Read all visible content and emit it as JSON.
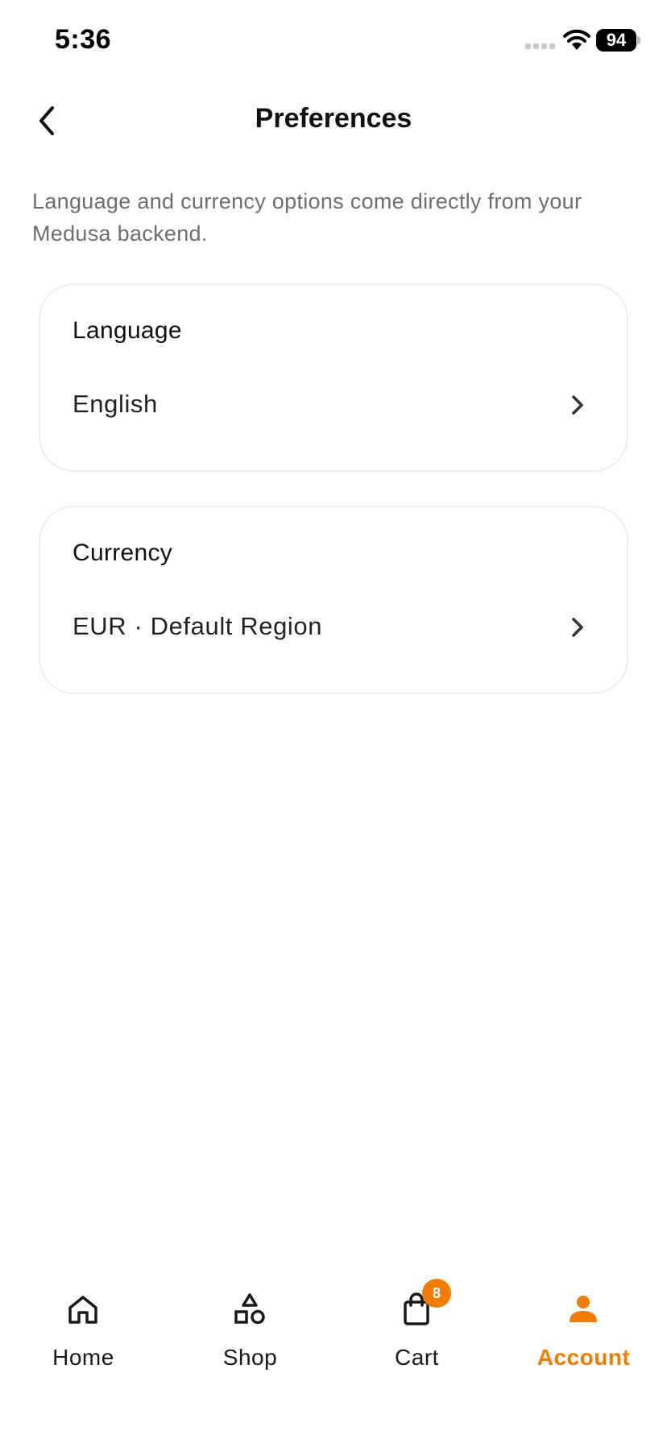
{
  "status_bar": {
    "time": "5:36",
    "battery": "94",
    "icons": [
      "cellular-signal-icon",
      "wifi-icon",
      "battery-icon"
    ]
  },
  "header": {
    "title": "Preferences",
    "back_icon": "chevron-left-icon"
  },
  "description": "Language and currency options come directly from your Medusa backend.",
  "preferences": {
    "language": {
      "label": "Language",
      "value": "English",
      "icon": "chevron-right-icon"
    },
    "currency": {
      "label": "Currency",
      "value": "EUR · Default Region",
      "icon": "chevron-right-icon"
    }
  },
  "tab_bar": {
    "active": "Account",
    "accent_color": "#f07d00",
    "tabs": [
      {
        "label": "Home",
        "icon": "home-icon"
      },
      {
        "label": "Shop",
        "icon": "shapes-icon"
      },
      {
        "label": "Cart",
        "icon": "shopping-bag-icon",
        "badge": "8"
      },
      {
        "label": "Account",
        "icon": "person-icon"
      }
    ]
  }
}
